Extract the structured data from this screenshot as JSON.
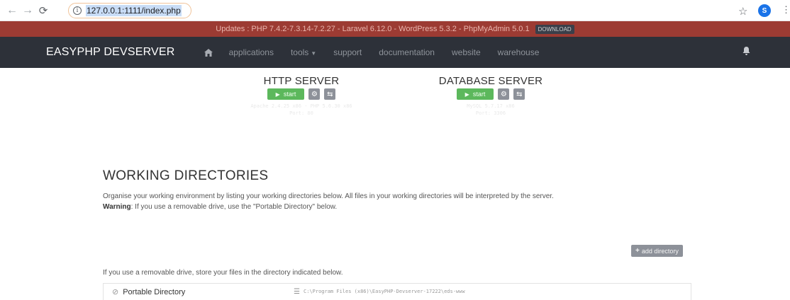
{
  "browser": {
    "url": "127.0.0.1:1111/index.php",
    "avatar_letter": "S"
  },
  "banner": {
    "text": "Updates : PHP 7.4.2-7.3.14-7.2.27 - Laravel 6.12.0 - WordPress 5.3.2 - PhpMyAdmin 5.0.1",
    "download_label": "DOWNLOAD",
    "color": "#9c3b33"
  },
  "navbar": {
    "brand": "EASYPHP DEVSERVER",
    "links": [
      "applications",
      "tools",
      "support",
      "documentation",
      "website",
      "warehouse"
    ],
    "color": "#2d3139"
  },
  "servers": {
    "http": {
      "title": "HTTP SERVER",
      "start_label": "start",
      "info_line1": "Apache 2.4.25 x86 - PHP 5.6.30 x86",
      "info_line2": "Port: 80"
    },
    "database": {
      "title": "DATABASE SERVER",
      "start_label": "start",
      "info_line1": "MySQL 5.7.17 x86",
      "info_line2": "Port: 3306"
    },
    "start_color": "#5cb85c"
  },
  "working_directories": {
    "title": "WORKING DIRECTORIES",
    "description": "Organise your working environment by listing your working directories below. All files in your working directories will be interpreted by the server.",
    "warning_label": "Warning",
    "warning_text": ": If you use a removable drive, use the \"Portable Directory\" below.",
    "add_label": "add directory",
    "note": "If you use a removable drive, store your files in the directory indicated below.",
    "portable_label": "Portable Directory",
    "portable_path": "C:\\Program Files (x86)\\EasyPHP-Devserver-17222\\eds-www"
  }
}
